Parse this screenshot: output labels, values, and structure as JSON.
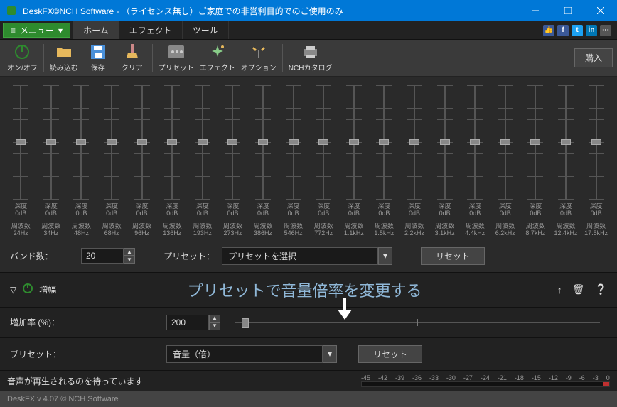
{
  "window": {
    "title": "DeskFX©NCH Software - （ライセンス無し）ご家庭での非営利目的でのご使用のみ"
  },
  "menu": {
    "main": "メニュー",
    "tabs": [
      "ホーム",
      "エフェクト",
      "ツール"
    ]
  },
  "toolbar": {
    "onoff": "オン/オフ",
    "load": "読み込む",
    "save": "保存",
    "clear": "クリア",
    "preset": "プリセット",
    "effect": "エフェクト",
    "option": "オプション",
    "catalog": "NCHカタログ",
    "buy": "購入"
  },
  "eq": {
    "depth": "深度",
    "depth_val": "0dB",
    "freq_label": "周波数",
    "bands": [
      "24Hz",
      "34Hz",
      "48Hz",
      "68Hz",
      "96Hz",
      "136Hz",
      "193Hz",
      "273Hz",
      "386Hz",
      "546Hz",
      "772Hz",
      "1.1kHz",
      "1.5kHz",
      "2.2kHz",
      "3.1kHz",
      "4.4kHz",
      "6.2kHz",
      "8.7kHz",
      "12.4kHz",
      "17.5kHz"
    ]
  },
  "bandrow": {
    "label": "バンド数：",
    "value": "20",
    "preset_label": "プリセット：",
    "preset_value": "プリセットを選択",
    "reset": "リセット"
  },
  "section": {
    "name": "増幅",
    "overlay": "プリセットで音量倍率を変更する"
  },
  "gain": {
    "label": "増加率 (%)：",
    "value": "200"
  },
  "preset2": {
    "label": "プリセット：",
    "value": "音量（倍）",
    "reset": "リセット"
  },
  "status": {
    "text": "音声が再生されるのを待っています",
    "ticks": [
      "-45",
      "-42",
      "-39",
      "-36",
      "-33",
      "-30",
      "-27",
      "-24",
      "-21",
      "-18",
      "-15",
      "-12",
      "-9",
      "-6",
      "-3",
      "0"
    ]
  },
  "footer": "DeskFX v 4.07  © NCH Software"
}
